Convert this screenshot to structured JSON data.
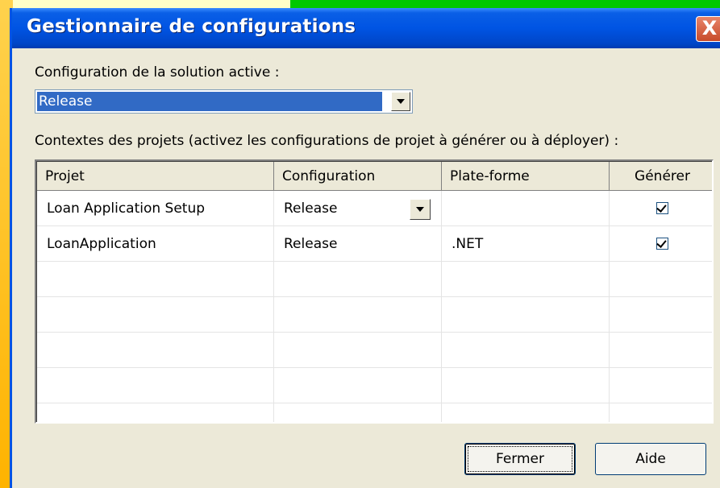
{
  "window": {
    "title": "Gestionnaire de configurations",
    "close_glyph": "X"
  },
  "active_config": {
    "label": "Configuration de la solution active :",
    "value": "Release"
  },
  "contexts": {
    "label": "Contextes des projets (activez les configurations de projet à générer ou à déployer) :"
  },
  "grid": {
    "columns": [
      "Projet",
      "Configuration",
      "Plate-forme",
      "Générer"
    ],
    "rows": [
      {
        "project": "Loan Application Setup",
        "configuration": "Release",
        "platform": "",
        "build": true
      },
      {
        "project": "LoanApplication",
        "configuration": "Release",
        "platform": ".NET",
        "build": true
      }
    ]
  },
  "buttons": {
    "close": "Fermer",
    "help": "Aide"
  },
  "colors": {
    "titlebar": "#0054e3",
    "dialog_bg": "#ece9d8",
    "selection": "#316ac5",
    "close_button": "#c74b2a"
  },
  "icons": {
    "close": "close-icon",
    "dropdown": "chevron-down-icon",
    "check": "checkmark-icon"
  }
}
